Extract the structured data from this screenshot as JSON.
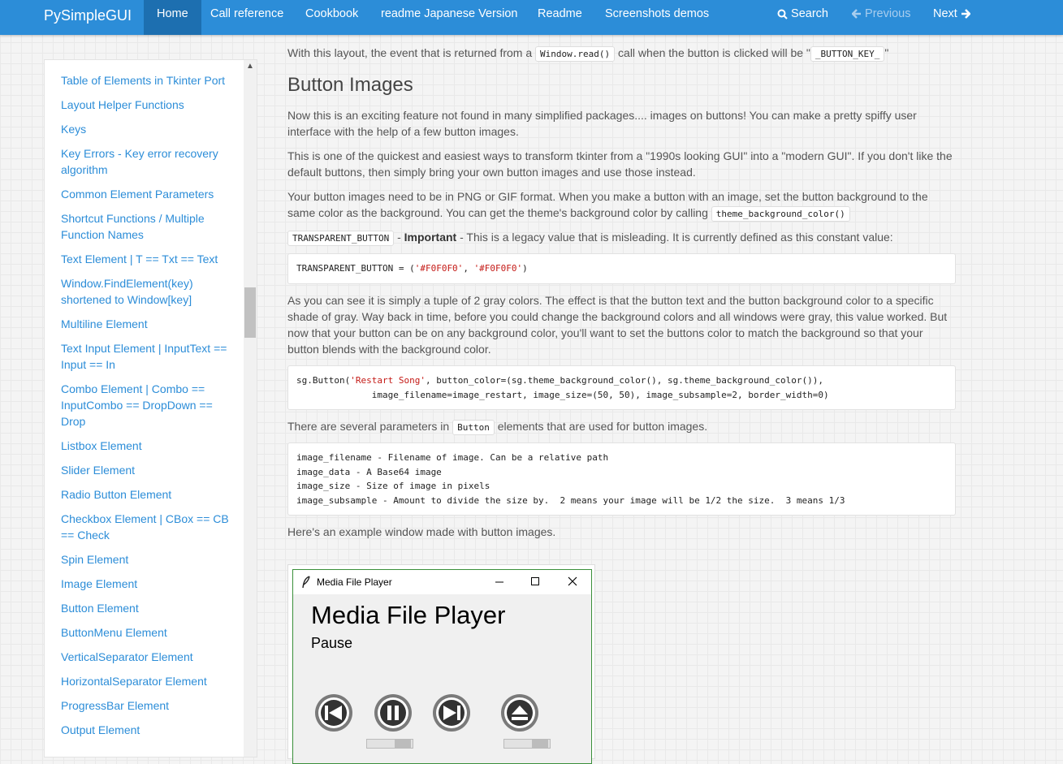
{
  "navbar": {
    "brand": "PySimpleGUI",
    "links": [
      "Home",
      "Call reference",
      "Cookbook",
      "readme Japanese Version",
      "Readme",
      "Screenshots demos"
    ],
    "search": "Search",
    "previous": "Previous",
    "next": "Next"
  },
  "sidebar": {
    "items": [
      "Table of Elements in Tkinter Port",
      "Layout Helper Functions",
      "Keys",
      "Key Errors - Key error recovery algorithm",
      "Common Element Parameters",
      "Shortcut Functions / Multiple Function Names",
      "Text Element | T == Txt == Text",
      "Window.FindElement(key) shortened to Window[key]",
      "Multiline Element",
      "Text Input Element | InputText == Input == In",
      "Combo Element | Combo == InputCombo == DropDown == Drop",
      "Listbox Element",
      "Slider Element",
      "Radio Button Element",
      "Checkbox Element | CBox == CB == Check",
      "Spin Element",
      "Image Element",
      "Button Element",
      "ButtonMenu Element",
      "VerticalSeparator Element",
      "HorizontalSeparator Element",
      "ProgressBar Element",
      "Output Element"
    ]
  },
  "content": {
    "intro_before": "With this layout, the event that is returned from a",
    "intro_code": "Window.read()",
    "intro_mid": "call when the button is clicked will be \"",
    "intro_code2": "_BUTTON_KEY_",
    "intro_end": "\"",
    "heading": "Button Images",
    "p1": "Now this is an exciting feature not found in many simplified packages.... images on buttons! You can make a pretty spiffy user interface with the help of a few button images.",
    "p2": "This is one of the quickest and easiest ways to transform tkinter from a \"1990s looking GUI\" into a \"modern GUI\". If you don't like the default buttons, then simply bring your own button images and use those instead.",
    "p3": "Your button images need to be in PNG or GIF format. When you make a button with an image, set the button background to the same color as the background. You can get the theme's background color by calling",
    "p3_code": "theme_background_color()",
    "p4_code": "TRANSPARENT_BUTTON",
    "p4_dash": " - ",
    "p4_strong": "Important",
    "p4_rest": " - This is a legacy value that is misleading. It is currently defined as this constant value:",
    "code1_a": "TRANSPARENT_BUTTON = (",
    "code1_s1": "'#F0F0F0'",
    "code1_b": ", ",
    "code1_s2": "'#F0F0F0'",
    "code1_c": ")",
    "p5": "As you can see it is simply a tuple of 2 gray colors. The effect is that the button text and the button background color to a specific shade of gray. Way back in time, before you could change the background colors and all windows were gray, this value worked. But now that your button can be on any background color, you'll want to set the buttons color to match the background so that your button blends with the background color.",
    "code2_l1a": "sg.Button(",
    "code2_l1s": "'Restart Song'",
    "code2_l1b": ", button_color=(sg.theme_background_color(), sg.theme_background_color()),",
    "code2_l2": "              image_filename=image_restart, image_size=(50, 50), image_subsample=2, border_width=0)",
    "p6_before": "There are several parameters in",
    "p6_code": "Button",
    "p6_after": "elements that are used for button images.",
    "code3": [
      "image_filename - Filename of image. Can be a relative path",
      "image_data - A Base64 image",
      "image_size - Size of image in pixels",
      "image_subsample - Amount to divide the size by.  2 means your image will be 1/2 the size.  3 means 1/3"
    ],
    "p7": "Here's an example window made with button images."
  },
  "media_player": {
    "window_title": "Media File Player",
    "heading": "Media File Player",
    "status": "Pause",
    "buttons": [
      "restart-icon",
      "pause-icon",
      "next-icon",
      "eject-icon"
    ]
  }
}
